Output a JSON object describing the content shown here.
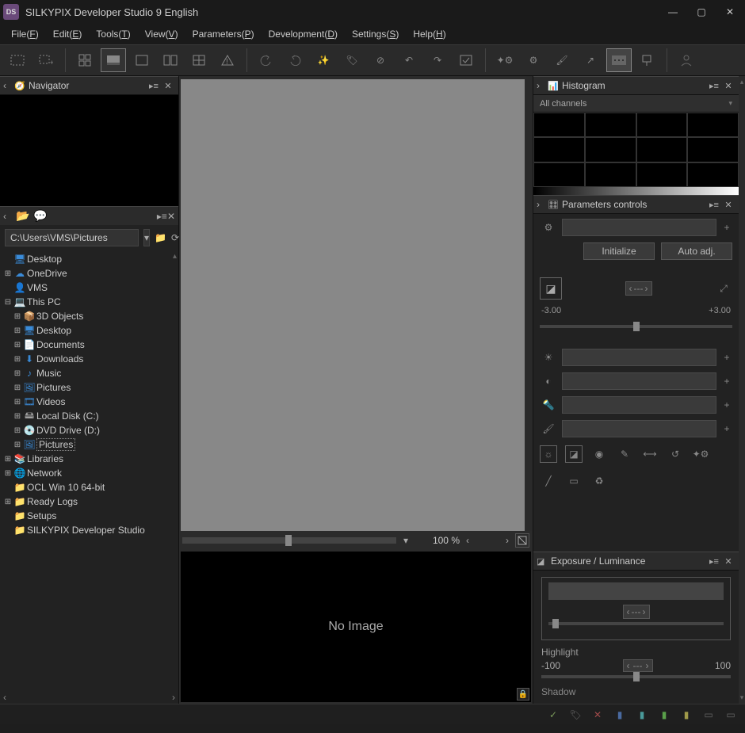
{
  "app": {
    "title": "SILKYPIX Developer Studio 9 English",
    "icon_label": "DS"
  },
  "menu": [
    {
      "label": "File",
      "key": "F"
    },
    {
      "label": "Edit",
      "key": "E"
    },
    {
      "label": "Tools",
      "key": "T"
    },
    {
      "label": "View",
      "key": "V"
    },
    {
      "label": "Parameters",
      "key": "P"
    },
    {
      "label": "Development",
      "key": "D"
    },
    {
      "label": "Settings",
      "key": "S"
    },
    {
      "label": "Help",
      "key": "H"
    }
  ],
  "navigator": {
    "title": "Navigator"
  },
  "browser": {
    "path": "C:\\Users\\VMS\\Pictures"
  },
  "tree": [
    {
      "depth": 0,
      "exp": "",
      "icon": "desktop",
      "label": "Desktop",
      "cls": "fc-blue"
    },
    {
      "depth": 0,
      "exp": "+",
      "icon": "cloud",
      "label": "OneDrive",
      "cls": "fc-blue"
    },
    {
      "depth": 0,
      "exp": "",
      "icon": "user",
      "label": "VMS",
      "cls": "fc-yellow"
    },
    {
      "depth": 0,
      "exp": "-",
      "icon": "pc",
      "label": "This PC",
      "cls": "fc-blue"
    },
    {
      "depth": 1,
      "exp": "+",
      "icon": "cube",
      "label": "3D Objects",
      "cls": "fc-green"
    },
    {
      "depth": 1,
      "exp": "+",
      "icon": "desktop",
      "label": "Desktop",
      "cls": "fc-blue"
    },
    {
      "depth": 1,
      "exp": "+",
      "icon": "doc",
      "label": "Documents",
      "cls": "fc-white"
    },
    {
      "depth": 1,
      "exp": "+",
      "icon": "down",
      "label": "Downloads",
      "cls": "fc-blue"
    },
    {
      "depth": 1,
      "exp": "+",
      "icon": "music",
      "label": "Music",
      "cls": "fc-blue"
    },
    {
      "depth": 1,
      "exp": "+",
      "icon": "pic",
      "label": "Pictures",
      "cls": "fc-blue"
    },
    {
      "depth": 1,
      "exp": "+",
      "icon": "video",
      "label": "Videos",
      "cls": "fc-blue"
    },
    {
      "depth": 1,
      "exp": "+",
      "icon": "drive",
      "label": "Local Disk (C:)",
      "cls": "fc-drive"
    },
    {
      "depth": 1,
      "exp": "+",
      "icon": "dvd",
      "label": "DVD Drive (D:)",
      "cls": "fc-drive"
    },
    {
      "depth": 1,
      "exp": "+",
      "icon": "pic",
      "label": "Pictures",
      "cls": "fc-blue",
      "selected": true
    },
    {
      "depth": 0,
      "exp": "+",
      "icon": "lib",
      "label": "Libraries",
      "cls": "fc-yellow"
    },
    {
      "depth": 0,
      "exp": "+",
      "icon": "net",
      "label": "Network",
      "cls": "fc-blue"
    },
    {
      "depth": 0,
      "exp": "",
      "icon": "folder",
      "label": "OCL Win 10 64-bit",
      "cls": "fc-yellow"
    },
    {
      "depth": 0,
      "exp": "+",
      "icon": "folder",
      "label": "Ready Logs",
      "cls": "fc-yellow"
    },
    {
      "depth": 0,
      "exp": "",
      "icon": "folder",
      "label": "Setups",
      "cls": "fc-yellow"
    },
    {
      "depth": 0,
      "exp": "",
      "icon": "folder",
      "label": "SILKYPIX Developer Studio",
      "cls": "fc-yellow"
    }
  ],
  "zoom": {
    "value": "100",
    "unit": "%"
  },
  "thumbnails": {
    "empty_text": "No Image"
  },
  "histogram": {
    "title": "Histogram",
    "channel": "All channels"
  },
  "parameters": {
    "title": "Parameters controls",
    "init_label": "Initialize",
    "auto_label": "Auto adj.",
    "spinner_placeholder": "---",
    "scale_min": "-3.00",
    "scale_max": "+3.00"
  },
  "exposure": {
    "title": "Exposure / Luminance",
    "spinner_placeholder": "---",
    "highlight_label": "Highlight",
    "highlight_min": "-100",
    "highlight_max": "100",
    "shadow_label": "Shadow"
  }
}
